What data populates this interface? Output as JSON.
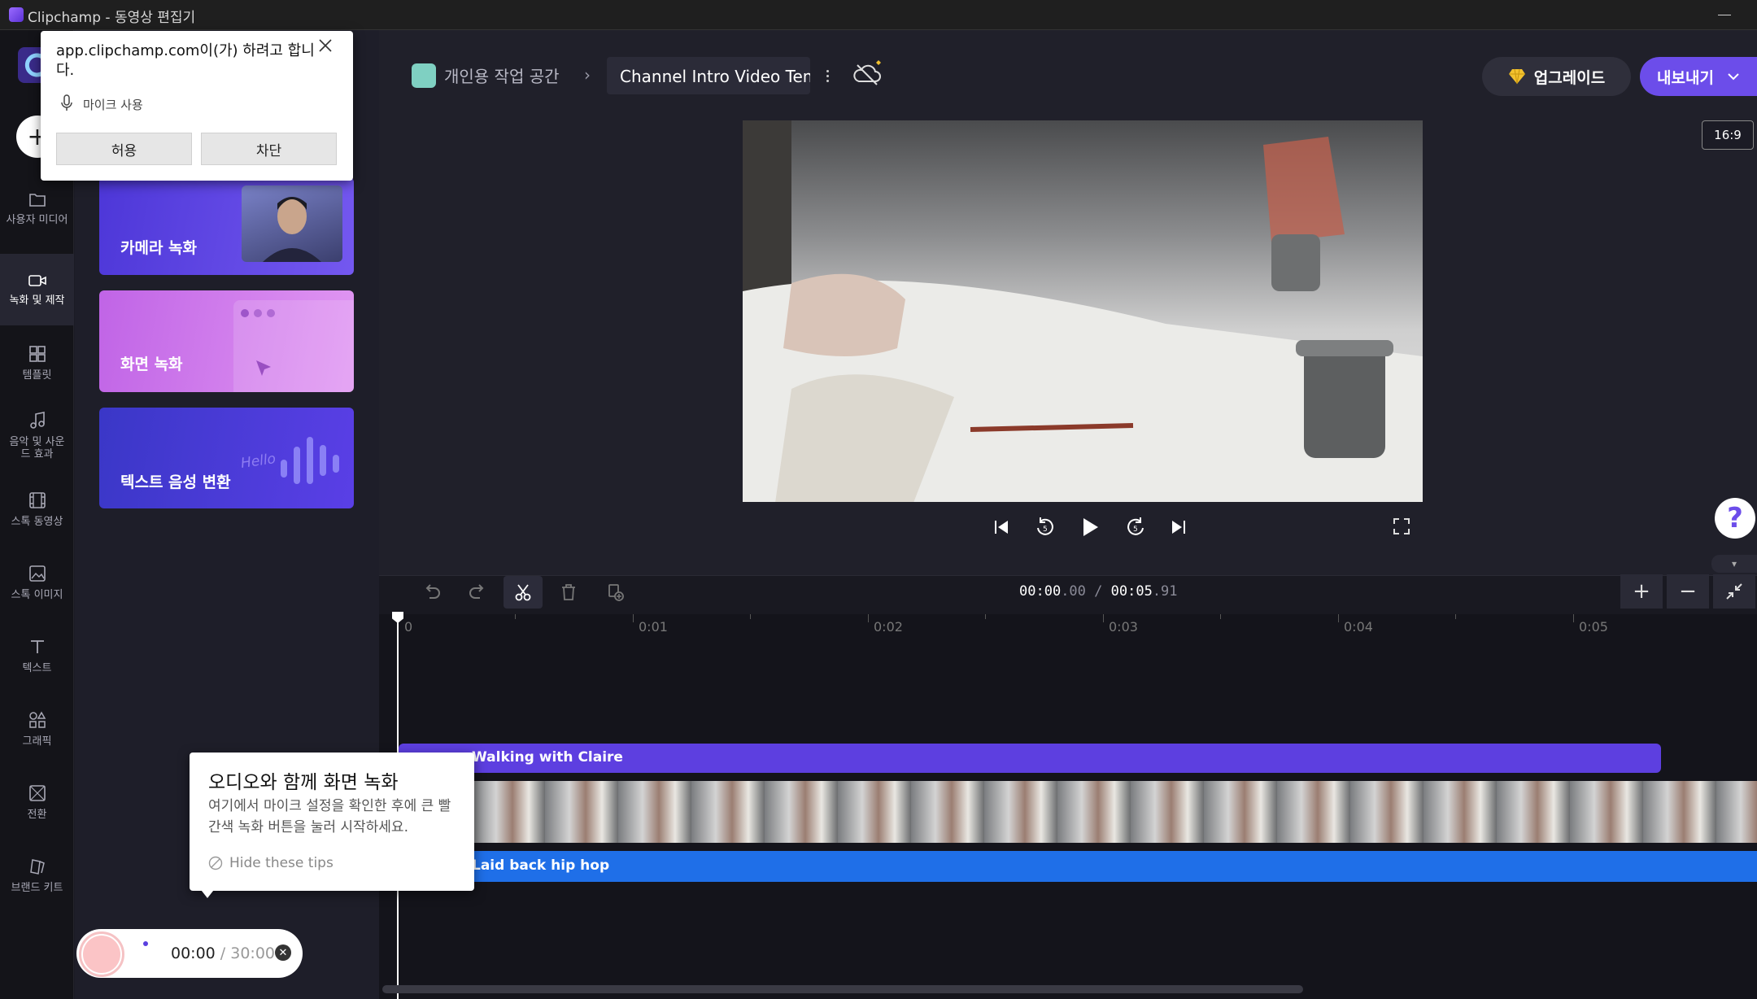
{
  "window": {
    "title": "Clipchamp - 동영상 편집기"
  },
  "sidebar": {
    "create_label": "+",
    "items": [
      {
        "label": "사용자 미디어",
        "icon": "folder-icon"
      },
      {
        "label": "녹화 및 제작",
        "icon": "camera-icon",
        "active": true
      },
      {
        "label": "템플릿",
        "icon": "templates-icon"
      },
      {
        "label": "음악 및 사운드 효과",
        "icon": "music-icon"
      },
      {
        "label": "스톡 동영상",
        "icon": "film-icon"
      },
      {
        "label": "스톡 이미지",
        "icon": "image-icon"
      },
      {
        "label": "텍스트",
        "icon": "text-icon"
      },
      {
        "label": "그래픽",
        "icon": "shapes-icon"
      },
      {
        "label": "전환",
        "icon": "transitions-icon"
      },
      {
        "label": "브랜드 키트",
        "icon": "brand-kit-icon"
      }
    ]
  },
  "panel": {
    "cards": [
      {
        "label": "카메라 녹화"
      },
      {
        "label": "화면 녹화"
      },
      {
        "label": "텍스트 음성 변환",
        "decor_text": "Hello"
      }
    ]
  },
  "header": {
    "workspace": "개인용 작업 공간",
    "separator": "›",
    "project_title": "Channel Intro Video Template",
    "upgrade_label": "업그레이드",
    "export_label": "내보내기",
    "aspect_ratio": "16:9"
  },
  "help": {
    "label": "?"
  },
  "timeline": {
    "timecode_current": "00:00",
    "timecode_current_frac": ".00",
    "timecode_sep": " / ",
    "timecode_total": "00:05",
    "timecode_total_frac": ".91",
    "ruler_labels": [
      "0",
      "0:01",
      "0:02",
      "0:03",
      "0:04",
      "0:05"
    ],
    "zoom_in": "+",
    "zoom_out": "−",
    "tracks": {
      "text_clip": "Walking with Claire",
      "audio_clip": "Laid back hip hop"
    }
  },
  "permission_popup": {
    "message": "app.clipchamp.com이(가) 하려고 합니다.",
    "permission": "마이크 사용",
    "allow": "허용",
    "block": "차단"
  },
  "tip": {
    "title": "오디오와 함께 화면 녹화",
    "body": "여기에서 마이크 설정을 확인한 후에 큰 빨간색 녹화 버튼을 눌러 시작하세요.",
    "hide": "Hide these tips"
  },
  "recorder": {
    "elapsed": "00:00",
    "sep": " / ",
    "limit": "30:00"
  },
  "colors": {
    "accent": "#6c4dea",
    "audio_track": "#1f6fe8",
    "text_track": "#5d3fe0",
    "record": "#fbc4c6"
  }
}
